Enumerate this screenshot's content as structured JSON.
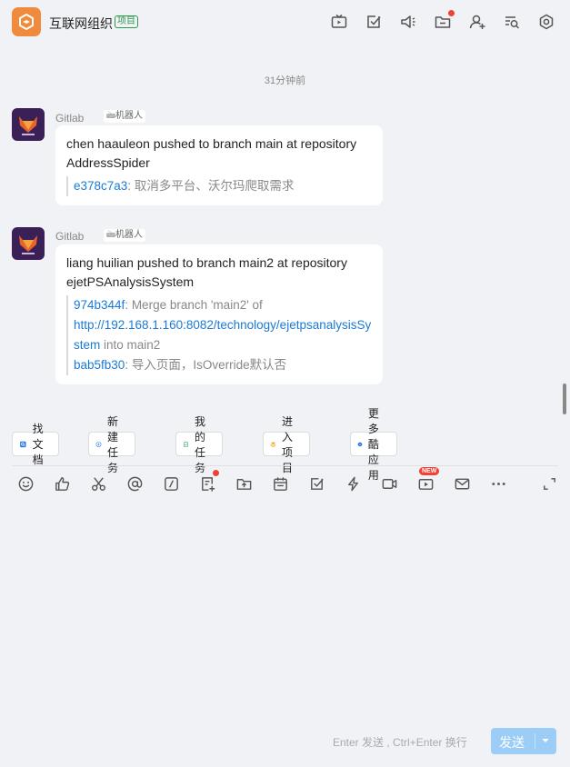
{
  "header": {
    "title": "互联网组织",
    "tag": "项目",
    "icons": [
      "tv-icon",
      "task-check-icon",
      "announcement-icon",
      "folder-icon",
      "add-member-icon",
      "search-list-icon",
      "settings-icon"
    ]
  },
  "chat": {
    "timestamp": "31分钟前",
    "messages": [
      {
        "sender": "Gitlab",
        "robot_label": "机器人",
        "text": "chen haauleon pushed to branch main at repository AddressSpider",
        "commits": [
          {
            "hash": "e378c7a3",
            "rest": ": 取消多平台、沃尔玛爬取需求"
          }
        ]
      },
      {
        "sender": "Gitlab",
        "robot_label": "机器人",
        "text": "liang huilian pushed to branch main2 at repository ejetPSAnalysisSystem",
        "commit1_hash": "974b344f",
        "commit1_text": ": Merge branch 'main2' of",
        "commit1_url": "http://192.168.1.160:8082/technology/ejetpsanalysisSystem",
        "commit1_tail": " into main2",
        "commit2_hash": "bab5fb30",
        "commit2_text": ": 导入页面，IsOverride默认否"
      }
    ]
  },
  "quick_actions": [
    "找文档",
    "新建任务",
    "我的任务",
    "进入项目",
    "更多酷应用"
  ],
  "toolbar": {
    "new_badge": "NEW",
    "icons": [
      "emoji-icon",
      "thumbs-up-icon",
      "scissors-icon",
      "mention-icon",
      "slash-command-icon",
      "doc-add-icon",
      "upload-icon",
      "calendar-icon",
      "task-icon",
      "lightning-icon",
      "video-icon",
      "live-icon",
      "mail-icon",
      "more-icon",
      "expand-icon"
    ]
  },
  "composer": {
    "hint": "Enter 发送 , Ctrl+Enter 换行",
    "send_label": "发送"
  },
  "colors": {
    "accent": "#1a7ad6",
    "brand": "#f08a3c",
    "send_disabled": "#9ccdf7"
  }
}
